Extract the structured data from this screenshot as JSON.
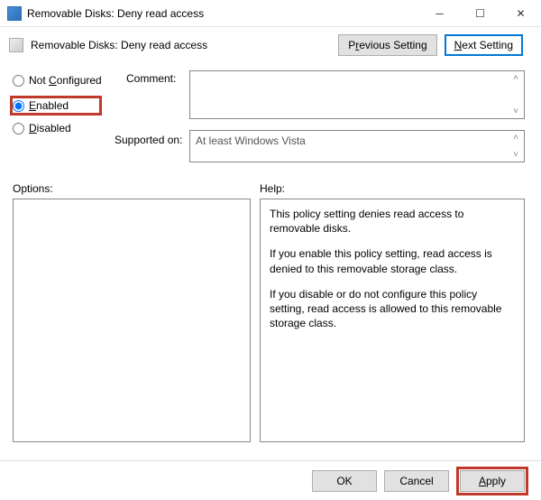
{
  "window": {
    "title": "Removable Disks: Deny read access"
  },
  "header": {
    "title": "Removable Disks: Deny read access"
  },
  "nav": {
    "previous_prefix": "P",
    "previous_underline": "r",
    "previous_suffix": "evious Setting",
    "next_underline": "N",
    "next_suffix": "ext Setting"
  },
  "radios": {
    "not_configured_prefix": "Not ",
    "not_configured_underline": "C",
    "not_configured_suffix": "onfigured",
    "enabled_underline": "E",
    "enabled_suffix": "nabled",
    "disabled_underline": "D",
    "disabled_suffix": "isabled",
    "selected": "enabled"
  },
  "labels": {
    "comment": "Comment:",
    "supported": "Supported on:",
    "options": "Options:",
    "help": "Help:"
  },
  "comment": "",
  "supported": "At least Windows Vista",
  "help": {
    "p1": "This policy setting denies read access to removable disks.",
    "p2": "If you enable this policy setting, read access is denied to this removable storage class.",
    "p3": "If you disable or do not configure this policy setting, read access is allowed to this removable storage class."
  },
  "footer": {
    "ok": "OK",
    "cancel": "Cancel",
    "apply_underline": "A",
    "apply_suffix": "pply"
  }
}
